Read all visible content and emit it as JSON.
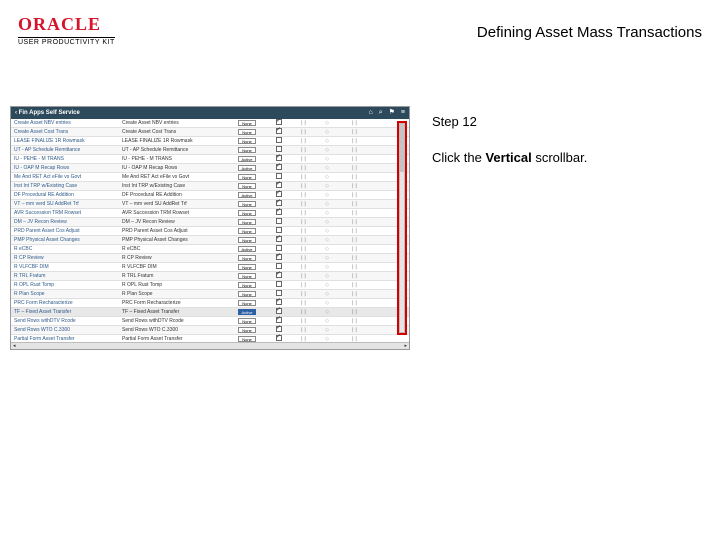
{
  "branding": {
    "logo_text": "ORACLE",
    "sub_text": "USER PRODUCTIVITY KIT"
  },
  "page_title": "Defining Asset Mass Transactions",
  "step_label": "Step 12",
  "instruction_prefix": "Click the ",
  "instruction_bold": "Vertical",
  "instruction_suffix": " scrollbar.",
  "app": {
    "header_title": "‹ Fin Apps Self Service",
    "header_icons": {
      "home": "⌂",
      "search": "⌕",
      "flag": "⚑",
      "menu": "≡"
    },
    "columns": {
      "col4_chk": "☐",
      "col5_pause": "❘❘",
      "col6_diamond": "◇"
    },
    "rows": [
      {
        "c1": "Create Asset NBV entries",
        "c2": "Create Asset NBV entries",
        "status": "None",
        "active": false,
        "chk": true
      },
      {
        "c1": "Create Asset Cost Trans",
        "c2": "Create Asset Cost Trans",
        "status": "None",
        "active": false,
        "chk": true
      },
      {
        "c1": "LEASE FINALIZE 1R Rowmask",
        "c2": "LEASE FINALIZE 1R Rowmask",
        "status": "None",
        "active": false,
        "chk": false
      },
      {
        "c1": "UT - AP Schedule Remittance",
        "c2": "UT - AP Schedule Remittance",
        "status": "None",
        "active": false,
        "chk": false
      },
      {
        "c1": "IU - PEHE - M TRANS",
        "c2": "IU - PEHE - M TRANS",
        "status": "Active",
        "active": false,
        "chk": true
      },
      {
        "c1": "IU - OAP M Recap Rows",
        "c2": "IU - OAP M Recap Rows",
        "status": "Active",
        "active": false,
        "chk": true
      },
      {
        "c1": "Me And RET Act eFile vs Govt",
        "c2": "Me And RET Act eFile vs Govt",
        "status": "None",
        "active": false,
        "chk": false
      },
      {
        "c1": "Inst Int TRP w/Existing Case",
        "c2": "Inst Int TRP w/Existing Case",
        "status": "None",
        "active": false,
        "chk": true
      },
      {
        "c1": "DF Procedural RE Addition",
        "c2": "DF Procedural RE Addition",
        "status": "Active",
        "active": false,
        "chk": true
      },
      {
        "c1": "VT – mm verd SU AddRet Trf",
        "c2": "VT – mm verd SU AddRet Trf",
        "status": "None",
        "active": false,
        "chk": true
      },
      {
        "c1": "AVR Succession TRM Rowset",
        "c2": "AVR Succession TRM Rowset",
        "status": "None",
        "active": false,
        "chk": true
      },
      {
        "c1": "DM – JV Recon Review",
        "c2": "DM – JV Recon Review",
        "status": "None",
        "active": false,
        "chk": false
      },
      {
        "c1": "PRD Parent Asset Cos Adjust",
        "c2": "PRD Parent Asset Cos Adjust",
        "status": "None",
        "active": false,
        "chk": false
      },
      {
        "c1": "PMP Physical Asset Changes",
        "c2": "PMP Physical Asset Changes",
        "status": "None",
        "active": false,
        "chk": true
      },
      {
        "c1": "R eCBC",
        "c2": "R eCBC",
        "status": "Active",
        "active": false,
        "chk": false
      },
      {
        "c1": "R CP Review",
        "c2": "R CP Review",
        "status": "None",
        "active": false,
        "chk": true
      },
      {
        "c1": "R VLFCBF DIM",
        "c2": "R VLFCBF DIM",
        "status": "None",
        "active": false,
        "chk": false
      },
      {
        "c1": "R TRL Fratum",
        "c2": "R TRL Fratum",
        "status": "None",
        "active": false,
        "chk": true
      },
      {
        "c1": "R OPL Rust Tomp",
        "c2": "R OPL Rust Tomp",
        "status": "None",
        "active": false,
        "chk": false
      },
      {
        "c1": "R Plan Scope",
        "c2": "R Plan Scope",
        "status": "None",
        "active": false,
        "chk": false
      },
      {
        "c1": "PRC Form Recharacterize",
        "c2": "PRC Form Recharacterize",
        "status": "None",
        "active": false,
        "chk": true
      },
      {
        "c1": "TF – Fixed Asset Transfer",
        "c2": "TF – Fixed Asset Transfer",
        "status": "Active",
        "active": true,
        "chk": true,
        "highlight": true
      },
      {
        "c1": "Send Rows withDTV Rcode",
        "c2": "Send Rows withDTV Rcode",
        "status": "None",
        "active": false,
        "chk": true
      },
      {
        "c1": "Send Rows WTO C.3300",
        "c2": "Send Rows WTO C.3300",
        "status": "None",
        "active": false,
        "chk": true
      },
      {
        "c1": "Partial Form Asset Transfer",
        "c2": "Partial Form Asset Transfer",
        "status": "None",
        "active": false,
        "chk": true
      }
    ],
    "hscroll": {
      "left": "◂",
      "right": "▸"
    }
  }
}
